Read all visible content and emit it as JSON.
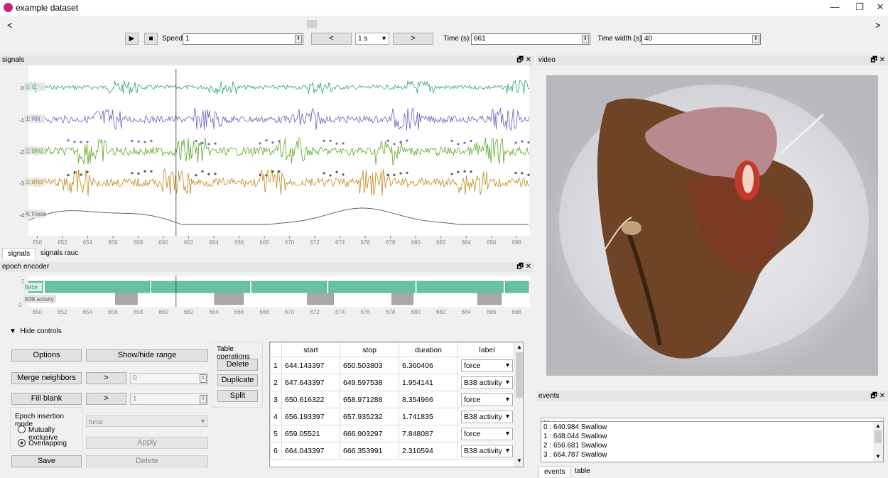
{
  "window": {
    "title": "example dataset",
    "min": "—",
    "max": "❐",
    "close": "✕"
  },
  "toolbar": {
    "prev_arrow": "<",
    "next_arrow": ">",
    "play": "▶",
    "stop": "■",
    "speed_label": "Speed:",
    "speed_value": "1",
    "step_back": "<",
    "step_value": "1 s",
    "step_forward": ">",
    "time_label": "Time (s):",
    "time_value": "661",
    "width_label": "Time width (s):",
    "width_value": "40"
  },
  "signals": {
    "title": "signals",
    "rows": [
      {
        "offset": "0",
        "label": "0: I2",
        "color": "#2aa27a"
      },
      {
        "offset": "-1",
        "label": "1: RN",
        "color": "#6a5fc1"
      },
      {
        "offset": "-2",
        "label": "2: BN2",
        "color": "#5ea62a"
      },
      {
        "offset": "-3",
        "label": "3: BN3",
        "color": "#c2881a"
      },
      {
        "offset": "-4",
        "label": "4: Force",
        "color": "#555555"
      }
    ],
    "xticks": [
      "650",
      "652",
      "654",
      "656",
      "658",
      "660",
      "662",
      "664",
      "666",
      "668",
      "670",
      "672",
      "674",
      "676",
      "678",
      "680",
      "682",
      "684",
      "686",
      "688"
    ],
    "tabs": [
      "signals",
      "signals rauc"
    ]
  },
  "epoch_encoder": {
    "title": "epoch encoder",
    "y2": "2",
    "y0": "0",
    "row_labels": [
      "force",
      "B38 activity"
    ],
    "xticks": [
      "650",
      "652",
      "654",
      "656",
      "658",
      "660",
      "662",
      "664",
      "666",
      "668",
      "670",
      "672",
      "674",
      "676",
      "678",
      "680",
      "682",
      "684",
      "686",
      "688"
    ],
    "hide_controls": "Hide controls",
    "options": "Options",
    "show_hide_range": "Show/hide range",
    "merge_neighbors": "Merge neighbors",
    "gt1": ">",
    "merge_value": "0",
    "fill_blank": "Fill blank",
    "gt2": ">",
    "fill_value": "1",
    "insertion_mode": "Epoch insertion mode",
    "mutually_exclusive": "Mutually exclusive",
    "overlapping": "Overlapping",
    "save": "Save",
    "label_select": "force",
    "apply": "Apply",
    "delete_disabled": "Delete",
    "table_ops_title": "Table operations",
    "delete": "Delete",
    "duplicate": "Duplicate",
    "split": "Split"
  },
  "table": {
    "headers": [
      "start",
      "stop",
      "duration",
      "label"
    ],
    "rows": [
      {
        "n": "1",
        "start": "644.143397",
        "stop": "650.503803",
        "duration": "6.360406",
        "label": "force"
      },
      {
        "n": "2",
        "start": "647.643397",
        "stop": "649.597538",
        "duration": "1.954141",
        "label": "B38 activity"
      },
      {
        "n": "3",
        "start": "650.616322",
        "stop": "658.971288",
        "duration": "8.354966",
        "label": "force"
      },
      {
        "n": "4",
        "start": "656.193397",
        "stop": "657.935232",
        "duration": "1.741835",
        "label": "B38 activity"
      },
      {
        "n": "5",
        "start": "659.05521",
        "stop": "666.903297",
        "duration": "7.848087",
        "label": "force"
      },
      {
        "n": "6",
        "start": "664.043397",
        "stop": "666.353991",
        "duration": "2.310594",
        "label": "B38 activity"
      }
    ]
  },
  "video": {
    "title": "video"
  },
  "events": {
    "title": "events",
    "select": "Motor pattern",
    "items": [
      "0 : 640.984 Swallow",
      "1 : 648.044 Swallow",
      "2 : 656.681 Swallow",
      "3 : 664.787 Swallow"
    ],
    "tabs": [
      "events",
      "table"
    ]
  },
  "dock_icons": {
    "float": "🗗",
    "close": "✕"
  }
}
